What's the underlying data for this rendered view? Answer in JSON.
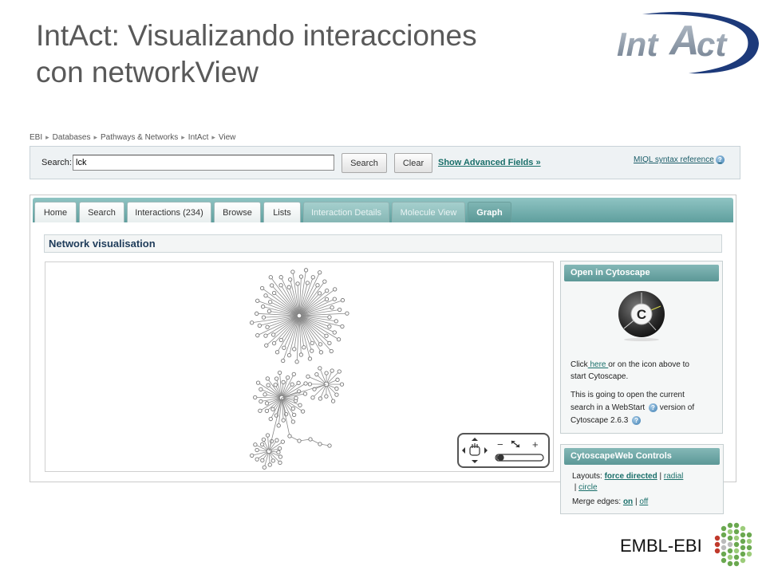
{
  "slide": {
    "title_line1": "IntAct: Visualizando interacciones",
    "title_line2": "con networkView"
  },
  "logos": {
    "intact_part1": "Int",
    "intact_part2": "A",
    "intact_part3": "ct",
    "embl_text": "EMBL-EBI"
  },
  "breadcrumb": [
    "EBI",
    "Databases",
    "Pathways & Networks",
    "IntAct",
    "View"
  ],
  "search": {
    "label": "Search:",
    "value": "lck",
    "search_button": "Search",
    "clear_button": "Clear",
    "advanced_link": "Show Advanced Fields »",
    "miql_link": "MIQL syntax reference"
  },
  "tabs": [
    {
      "label": "Home",
      "state": "normal"
    },
    {
      "label": "Search",
      "state": "normal"
    },
    {
      "label": "Interactions (234)",
      "state": "normal"
    },
    {
      "label": "Browse",
      "state": "normal"
    },
    {
      "label": "Lists",
      "state": "normal"
    },
    {
      "label": "Interaction Details",
      "state": "disabled"
    },
    {
      "label": "Molecule View",
      "state": "disabled"
    },
    {
      "label": "Graph",
      "state": "active"
    }
  ],
  "section": {
    "title": "Network visualisation"
  },
  "nav_control": {
    "zoom_out": "−",
    "zoom_in": "+",
    "zoom_level": 0.05
  },
  "cytoscape_box": {
    "header": "Open in Cytoscape",
    "icon_letter": "C",
    "p1_before": "Click",
    "p1_link": " here ",
    "p1_after": "or on the icon above to",
    "p1_line2": "start Cytoscape.",
    "p2_line1": "This is going to open the current",
    "p2_line2_before": "search in a WebStart",
    "p2_line2_after": "version of",
    "p2_line3": "Cytoscape 2.6.3"
  },
  "web_controls": {
    "header": "CytoscapeWeb Controls",
    "layouts_label": "Layouts:",
    "layout_force": "force directed",
    "layout_radial": "radial",
    "layout_circle": "circle",
    "pipe": "|",
    "merge_label": "Merge edges:",
    "merge_on": "on",
    "merge_off": "off"
  },
  "colors": {
    "teal": "#5f9f9e",
    "link": "#1a6f6a",
    "intact_blue": "#1d3a7a",
    "intact_gray": "#7e8c9c"
  }
}
